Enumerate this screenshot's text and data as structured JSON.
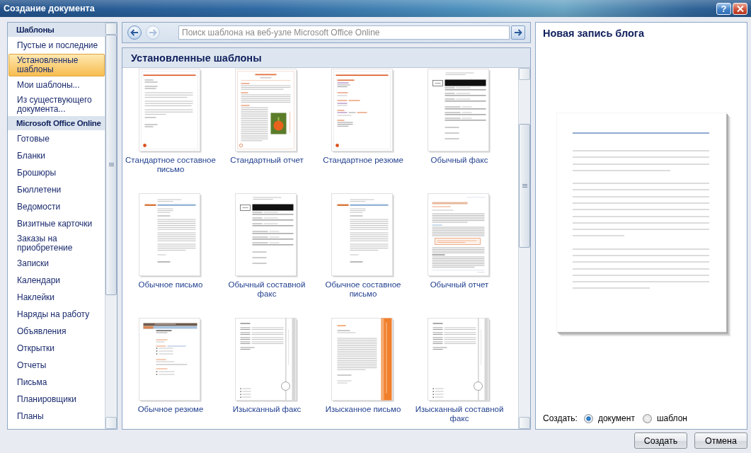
{
  "window": {
    "title": "Создание документа",
    "help_button": "?"
  },
  "sidebar": {
    "sections": [
      {
        "title": "Шаблоны",
        "items": [
          {
            "label": "Пустые и последние",
            "selected": false
          },
          {
            "label": "Установленные шаблоны",
            "selected": true
          },
          {
            "label": "Мои шаблоны...",
            "selected": false
          },
          {
            "label": "Из существующего документа...",
            "selected": false
          }
        ]
      },
      {
        "title": "Microsoft Office Online",
        "items": [
          {
            "label": "Готовые",
            "selected": false
          },
          {
            "label": "Бланки",
            "selected": false
          },
          {
            "label": "Брошюры",
            "selected": false
          },
          {
            "label": "Бюллетени",
            "selected": false
          },
          {
            "label": "Ведомости",
            "selected": false
          },
          {
            "label": "Визитные карточки",
            "selected": false
          },
          {
            "label": "Заказы на приобретение",
            "selected": false
          },
          {
            "label": "Записки",
            "selected": false
          },
          {
            "label": "Календари",
            "selected": false
          },
          {
            "label": "Наклейки",
            "selected": false
          },
          {
            "label": "Наряды на работу",
            "selected": false
          },
          {
            "label": "Объявления",
            "selected": false
          },
          {
            "label": "Открытки",
            "selected": false
          },
          {
            "label": "Отчеты",
            "selected": false
          },
          {
            "label": "Письма",
            "selected": false
          },
          {
            "label": "Планировщики",
            "selected": false
          },
          {
            "label": "Планы",
            "selected": false
          }
        ]
      }
    ]
  },
  "toolbar": {
    "back": {
      "disabled": false
    },
    "forward": {
      "disabled": true
    },
    "search": {
      "placeholder": "Поиск шаблона на веб-узле Microsoft Office Online"
    }
  },
  "templates": {
    "title": "Установленные шаблоны",
    "items": [
      {
        "label": "Стандартное составное письмо",
        "kind": "standard-letter",
        "selected": false
      },
      {
        "label": "Стандартный отчет",
        "kind": "standard-report",
        "selected": false
      },
      {
        "label": "Стандартное резюме",
        "kind": "standard-resume",
        "selected": false
      },
      {
        "label": "Обычный факс",
        "kind": "classic-fax",
        "selected": false
      },
      {
        "label": "Обычное письмо",
        "kind": "classic-letter",
        "selected": false
      },
      {
        "label": "Обычный составной факс",
        "kind": "classic-fax",
        "selected": false
      },
      {
        "label": "Обычное составное письмо",
        "kind": "classic-letter",
        "selected": false
      },
      {
        "label": "Обычный отчет",
        "kind": "classic-report",
        "selected": false
      },
      {
        "label": "Обычное резюме",
        "kind": "classic-resume",
        "selected": false
      },
      {
        "label": "Изысканный факс",
        "kind": "elegant-fax",
        "selected": false
      },
      {
        "label": "Изысканное письмо",
        "kind": "elegant-letter",
        "selected": false
      },
      {
        "label": "Изысканный составной факс",
        "kind": "elegant-fax",
        "selected": false
      }
    ]
  },
  "preview": {
    "title": "Новая запись блога",
    "create_label": "Создать:",
    "options": [
      {
        "label": "документ",
        "selected": true
      },
      {
        "label": "шаблон",
        "selected": false
      }
    ]
  },
  "buttons": [
    "Создать",
    "Отмена"
  ]
}
